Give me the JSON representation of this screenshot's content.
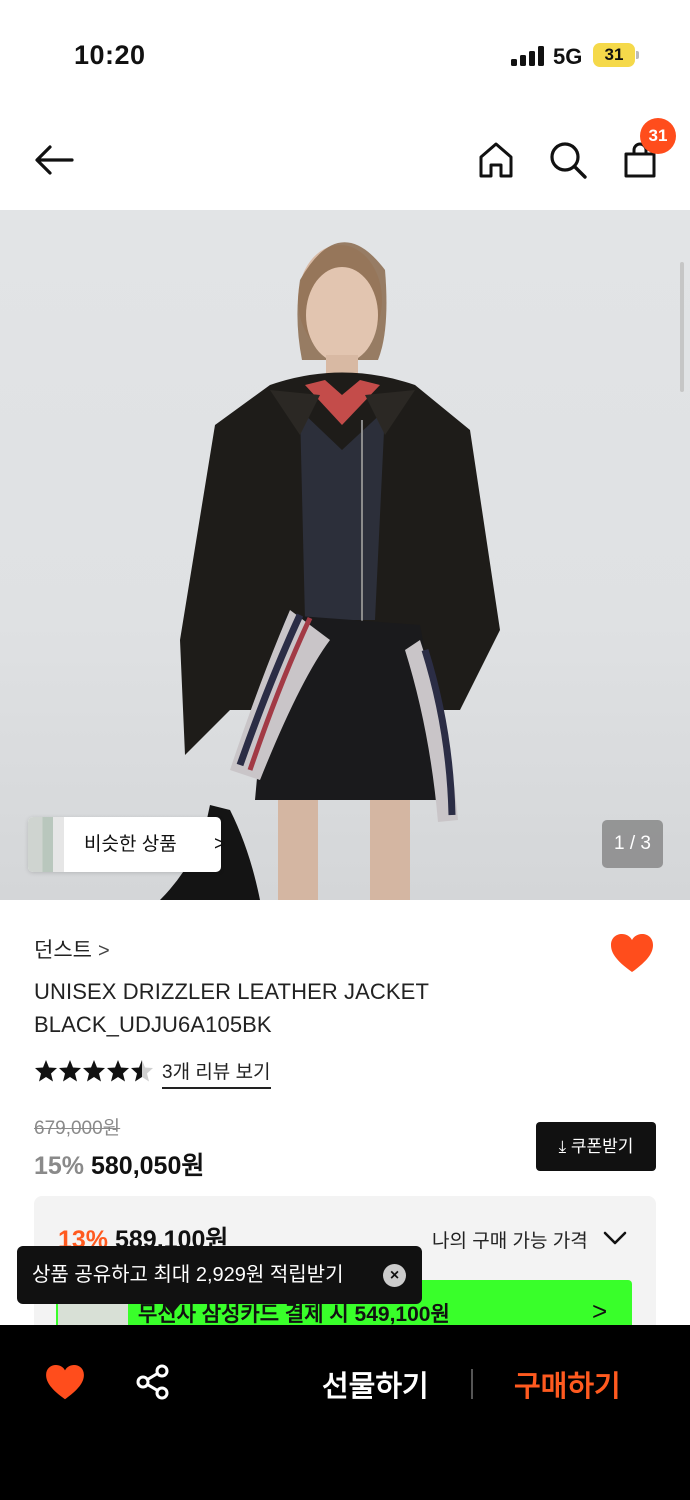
{
  "status_bar": {
    "time": "10:20",
    "network": "5G",
    "battery": "31"
  },
  "nav": {
    "cart_count": "31"
  },
  "hero": {
    "similar_label": "비슷한 상품",
    "similar_chevron": ">",
    "page_indicator": "1 / 3"
  },
  "product": {
    "brand": "던스트",
    "brand_chevron": ">",
    "title": "UNISEX DRIZZLER LEATHER JACKET BLACK_UDJU6A105BK",
    "rating": 4.5,
    "review_link": "3개 리뷰 보기",
    "original_price": "679,000원",
    "discount_pct": "15%",
    "sale_price": "580,050원",
    "coupon_label": "⤓ 쿠폰받기"
  },
  "benefit": {
    "discount_pct": "13%",
    "price": "589,100원",
    "my_price_link": "나의 구매 가능 가격",
    "card_offer": "무신사 삼성카드 결제 시 549,100원",
    "card_chevron": ">"
  },
  "toast": {
    "text": "상품 공유하고 최대 2,929원 적립받기",
    "close": "×"
  },
  "bottom_bar": {
    "gift_label": "선물하기",
    "buy_label": "구매하기"
  },
  "colors": {
    "accent": "#ff5a1f",
    "card_banner": "#39ff2a",
    "badge": "#ff4d1c",
    "heart": "#ff4d1c"
  }
}
